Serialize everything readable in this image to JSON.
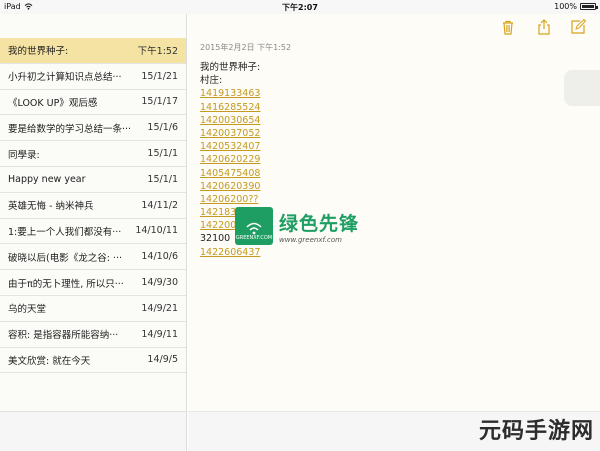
{
  "status_bar": {
    "device": "iPad",
    "time": "下午2:07",
    "battery": "100%"
  },
  "notes": [
    {
      "title": "我的世界种子:",
      "date": "下午1:52",
      "selected": true
    },
    {
      "title": "小升初之计算知识点总结···",
      "date": "15/1/21"
    },
    {
      "title": "《LOOK UP》观后感",
      "date": "15/1/17"
    },
    {
      "title": "要是给数学的学习总结一条···",
      "date": "15/1/6"
    },
    {
      "title": "同學录:",
      "date": "15/1/1"
    },
    {
      "title": "Happy new year",
      "date": "15/1/1"
    },
    {
      "title": "英雄无悔 - 纳米神兵",
      "date": "14/11/2"
    },
    {
      "title": "1:要上一个人我们都没有···",
      "date": "14/10/11"
    },
    {
      "title": "破晓以后(电影《龙之谷: ···",
      "date": "14/10/6"
    },
    {
      "title": "由于π的无卜理性, 所以只···",
      "date": "14/9/30"
    },
    {
      "title": "乌的天堂",
      "date": "14/9/21"
    },
    {
      "title": "容积: 是指容器所能容纳···",
      "date": "14/9/11"
    },
    {
      "title": "美文欣赏: 就在今天",
      "date": "14/9/5"
    }
  ],
  "toolbar": {
    "trash": "trash-icon",
    "share": "share-icon",
    "compose": "compose-icon"
  },
  "note": {
    "timestamp": "2015年2月2日 下午1:52",
    "lines": [
      {
        "text": "我的世界种子:",
        "link": false
      },
      {
        "text": "村庄:",
        "link": false
      },
      {
        "text": "1419133463",
        "link": true
      },
      {
        "text": "1416285524",
        "link": true
      },
      {
        "text": "1420030654",
        "link": true
      },
      {
        "text": "1420037052",
        "link": true
      },
      {
        "text": "1420532407",
        "link": true
      },
      {
        "text": "1420620229",
        "link": true
      },
      {
        "text": "1405475408",
        "link": true
      },
      {
        "text": "1420620390",
        "link": true
      },
      {
        "text": "14206200??",
        "link": true
      },
      {
        "text": "142183",
        "link": true
      },
      {
        "text": "142200",
        "link": true
      },
      {
        "text": "32100",
        "link": false
      },
      {
        "text": "1422606437",
        "link": true
      }
    ]
  },
  "watermark_center": {
    "logo_text": "GREENXF.COM",
    "title": "绿色先锋",
    "url": "www.greenxf.com"
  },
  "watermark_corner": {
    "text": "元码手游网"
  },
  "colors": {
    "selected_row": "#f5e3a3",
    "link": "#c49a20",
    "accent": "#d9a21a"
  }
}
